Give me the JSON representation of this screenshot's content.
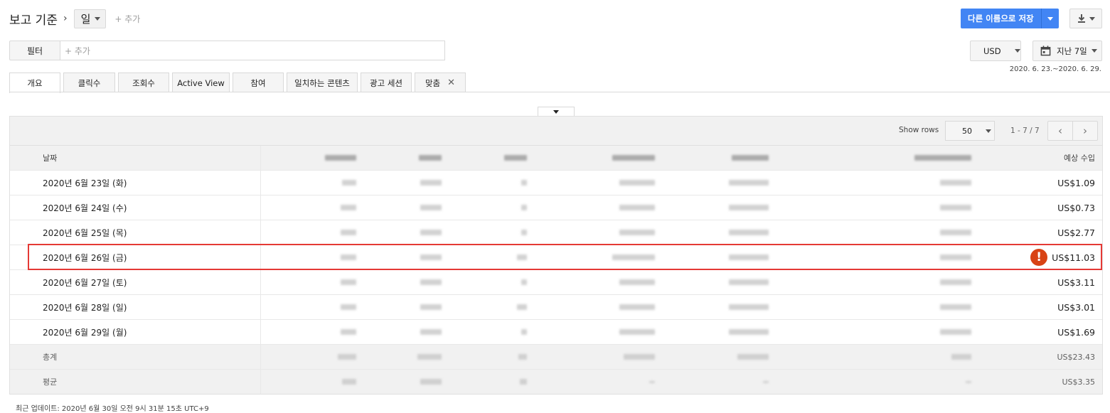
{
  "breadcrumb": {
    "title": "보고 기준",
    "separator": "›",
    "unit": "일",
    "add": "+ 추가"
  },
  "toolbar": {
    "save_label": "다른 이름으로 저장"
  },
  "filter": {
    "label": "필터",
    "placeholder": "+ 추가"
  },
  "currency": "USD",
  "date_select": {
    "label": "지난 7일",
    "range": "2020. 6. 23.~2020. 6. 29."
  },
  "tabs": [
    {
      "label": "개요",
      "active": true
    },
    {
      "label": "클릭수"
    },
    {
      "label": "조회수"
    },
    {
      "label": "Active View"
    },
    {
      "label": "참여"
    },
    {
      "label": "일치하는 콘텐츠"
    },
    {
      "label": "광고 세션"
    },
    {
      "label": "맞춤",
      "closable": true,
      "close_glyph": "✕"
    }
  ],
  "table": {
    "show_rows_label": "Show rows",
    "rows_per_page": "50",
    "page_info": "1 - 7 / 7",
    "prev_glyph": "‹",
    "next_glyph": "›",
    "columns": {
      "date": "날짜",
      "revenue": "예상 수입"
    },
    "rows": [
      {
        "date": "2020년 6월 23일 (화)",
        "revenue": "US$1.09"
      },
      {
        "date": "2020년 6월 24일 (수)",
        "revenue": "US$0.73"
      },
      {
        "date": "2020년 6월 25일 (목)",
        "revenue": "US$2.77"
      },
      {
        "date": "2020년 6월 26일 (금)",
        "revenue": "US$11.03",
        "alert": true,
        "alert_glyph": "!"
      },
      {
        "date": "2020년 6월 27일 (토)",
        "revenue": "US$3.11"
      },
      {
        "date": "2020년 6월 28일 (일)",
        "revenue": "US$3.01"
      },
      {
        "date": "2020년 6월 29일 (월)",
        "revenue": "US$1.69"
      }
    ],
    "total": {
      "label": "총계",
      "revenue": "US$23.43"
    },
    "average": {
      "label": "평균",
      "revenue": "US$3.35"
    }
  },
  "footer": "최근 업데이트: 2020년 6월 30일 오전 9시 31분 15초 UTC+9",
  "colors": {
    "primary": "#4285f4",
    "highlight": "#e53935",
    "alert": "#d84315"
  }
}
